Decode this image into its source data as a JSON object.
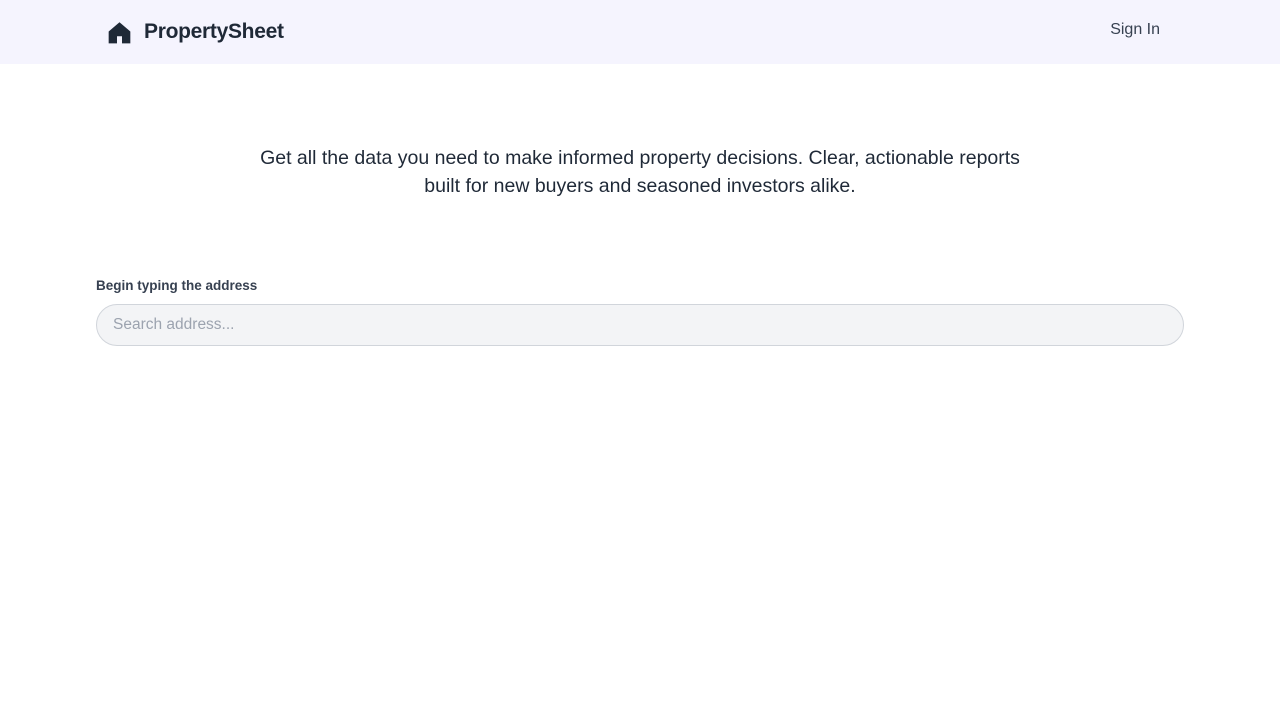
{
  "header": {
    "brand_name": "PropertySheet",
    "brand_icon": "house-icon",
    "signin_label": "Sign In"
  },
  "hero": {
    "tagline": "Get all the data you need to make informed property decisions. Clear, actionable reports built for new buyers and seasoned investors alike."
  },
  "search": {
    "label": "Begin typing the address",
    "placeholder": "Search address...",
    "value": ""
  },
  "colors": {
    "header_bg": "#f5f4fe",
    "text_dark": "#1f2937",
    "input_bg": "#f3f4f6",
    "input_border": "#d1d5db",
    "placeholder": "#9ca3af"
  }
}
